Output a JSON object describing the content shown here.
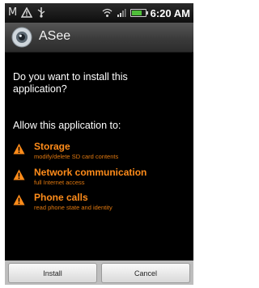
{
  "status_bar": {
    "carrier_glyph": "M",
    "time": "6:20 AM",
    "icons": [
      "gmail-icon",
      "warning-icon",
      "usb-icon",
      "wifi-icon",
      "signal-icon",
      "battery-icon"
    ]
  },
  "app": {
    "title": "ASee",
    "icon": "camera-eye-icon"
  },
  "dialog": {
    "question": "Do you want to install this application?",
    "allow_label": "Allow this application to:",
    "permissions": [
      {
        "title": "Storage",
        "description": "modify/delete SD card contents"
      },
      {
        "title": "Network communication",
        "description": "full Internet access"
      },
      {
        "title": "Phone calls",
        "description": "read phone state and identity"
      }
    ]
  },
  "buttons": {
    "install": "Install",
    "cancel": "Cancel"
  },
  "colors": {
    "permission_title": "#ff8c1a",
    "permission_description": "#e0780f",
    "warning_icon": "#ff8c1a",
    "background": "#000000"
  }
}
